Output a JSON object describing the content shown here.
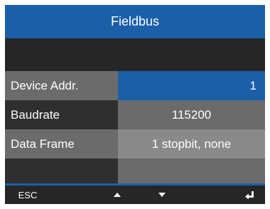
{
  "header": {
    "title": "Fieldbus"
  },
  "rows": [
    {
      "label": "Device Addr.",
      "value": "1"
    },
    {
      "label": "Baudrate",
      "value": "115200"
    },
    {
      "label": "Data Frame",
      "value": "1 stopbit, none"
    }
  ],
  "softkeys": {
    "esc_label": "ESC",
    "up_icon": "triangle-up-icon",
    "down_icon": "triangle-down-icon",
    "enter_icon": "enter-return-icon"
  },
  "colors": {
    "accent": "#1a5fa8",
    "background": "#262626",
    "cell_gray": "#6b6b6b",
    "cell_light_gray": "#8a8a8a"
  }
}
